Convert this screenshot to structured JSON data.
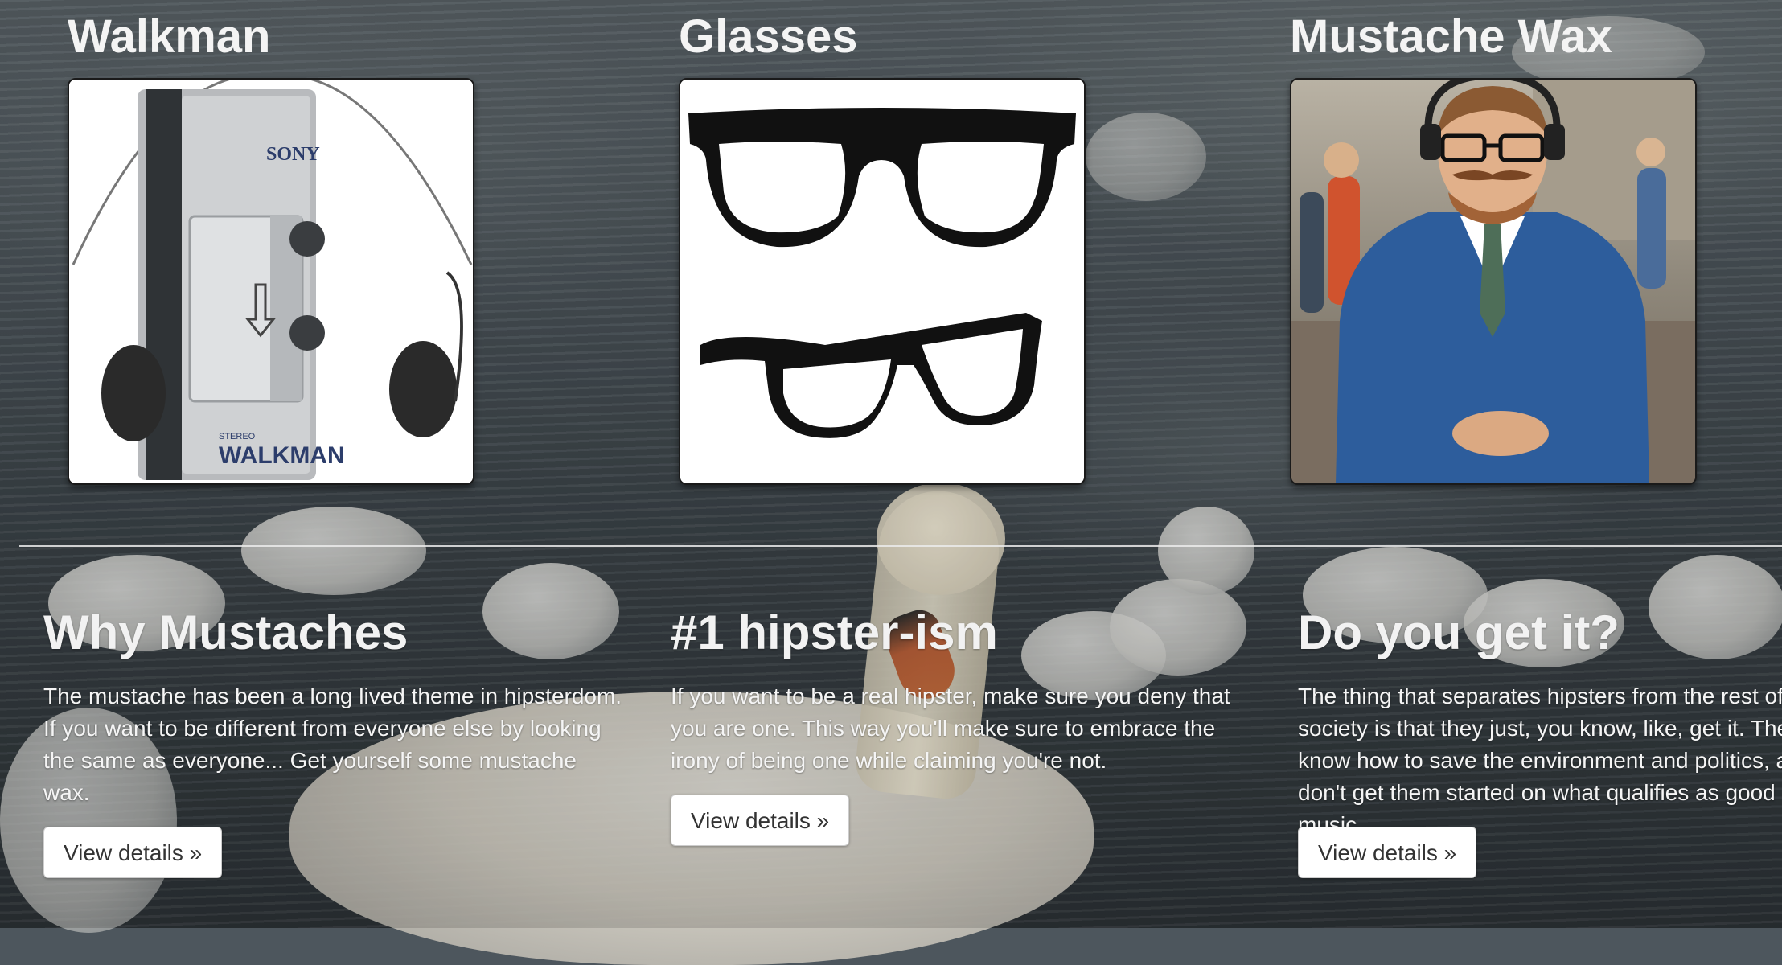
{
  "products": [
    {
      "title": "Walkman",
      "image_label": "SONY",
      "image_brand_text": "WALKMAN",
      "image_sub_text": "STEREO"
    },
    {
      "title": "Glasses"
    },
    {
      "title": "Mustache Wax"
    }
  ],
  "features": [
    {
      "heading": "Why Mustaches",
      "text": "The mustache has been a long lived theme in hipsterdom. If you want to be different from everyone else by looking the same as everyone... Get yourself some mustache wax.",
      "button": "View details »"
    },
    {
      "heading": "#1 hipster-ism",
      "text": "If you want to be a real hipster, make sure you deny that you are one. This way you'll make sure to embrace the irony of being one while claiming you're not.",
      "button": "View details »"
    },
    {
      "heading": "Do you get it?",
      "text": "The thing that separates hipsters from the rest of society is that they just, you know, like, get it. They know how to save the environment and politics, and don't get them started on what qualifies as good music.",
      "button": "View details »"
    }
  ]
}
